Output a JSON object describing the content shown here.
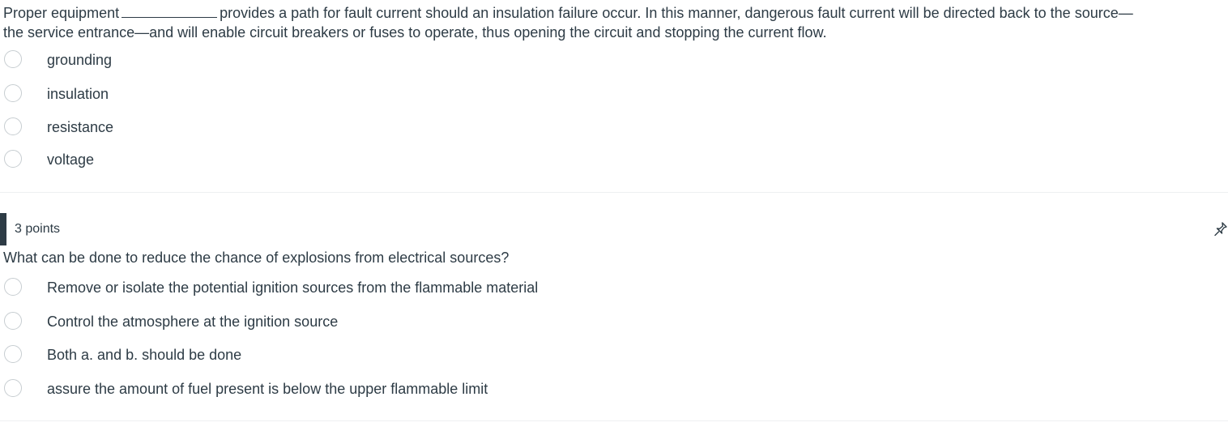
{
  "question1": {
    "text_before_blank": "Proper equipment",
    "text_after_blank_line1": "provides a path for fault current should an insulation failure occur. In this manner, dangerous fault current will be directed back to the source—",
    "text_line2": "the service entrance—and will enable circuit breakers or fuses to operate, thus opening the circuit and stopping the current flow.",
    "answers": [
      {
        "label": "grounding"
      },
      {
        "label": "insulation"
      },
      {
        "label": "resistance"
      },
      {
        "label": "voltage"
      }
    ]
  },
  "question2": {
    "points": "3 points",
    "text": "What can be done to reduce the chance of explosions from electrical sources?",
    "answers": [
      {
        "label": "Remove or isolate the potential ignition sources from the flammable material"
      },
      {
        "label": "Control the atmosphere at the ignition source"
      },
      {
        "label": "Both a. and b. should be done"
      },
      {
        "label": "assure the amount of fuel present is below the upper flammable limit"
      }
    ]
  },
  "icons": {
    "radio": "radio-empty-icon",
    "pin": "pin-icon"
  },
  "colors": {
    "text": "#2d3b45",
    "radio_border": "#c7cdd1",
    "divider": "#eef0f1",
    "header_bar": "#2d3b45"
  }
}
